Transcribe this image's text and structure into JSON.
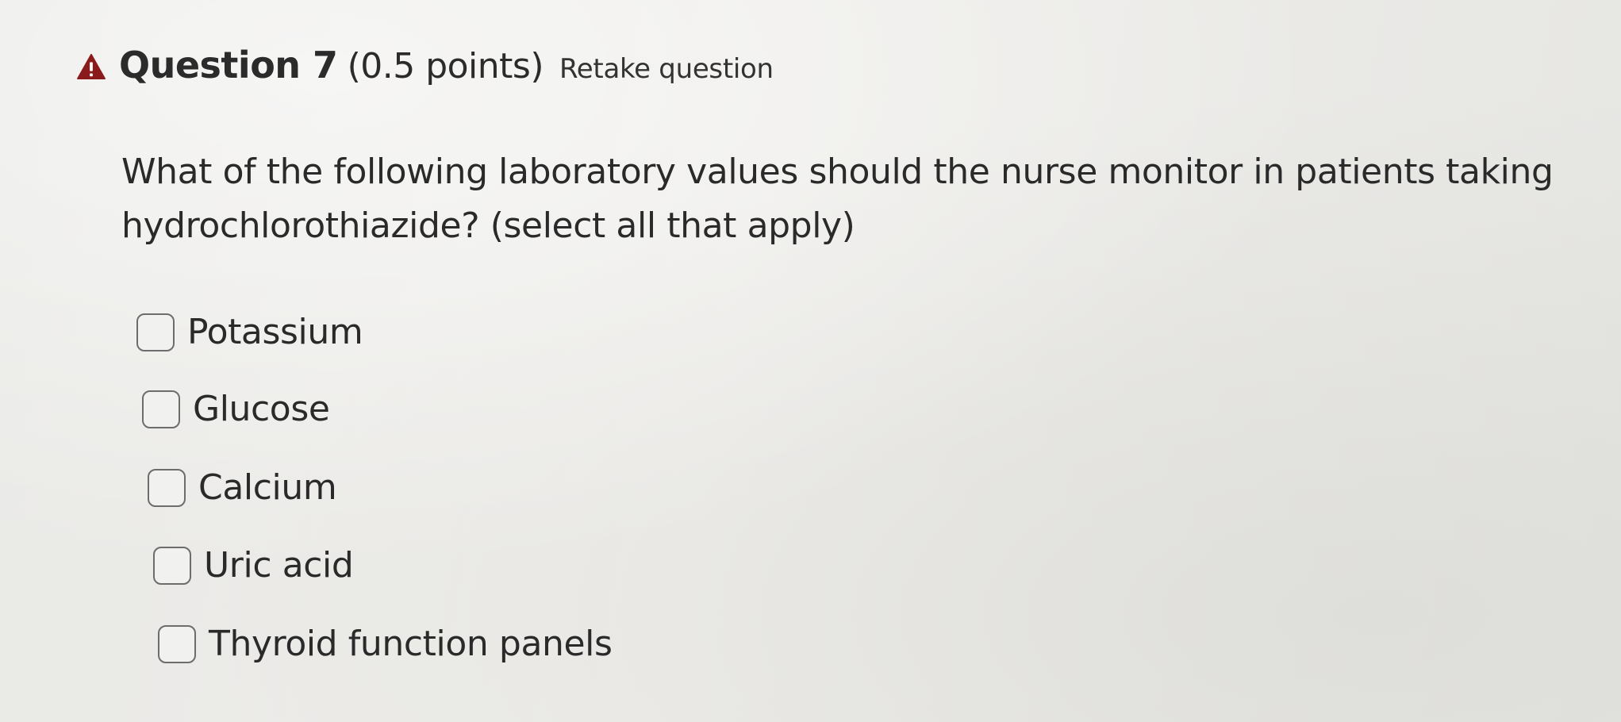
{
  "question": {
    "title": "Question 7",
    "points": "(0.5 points)",
    "retake_label": "Retake question",
    "text": "What of the following laboratory values should the nurse monitor in patients taking hydrochlorothiazide? (select all that apply)",
    "options": [
      {
        "label": "Potassium",
        "checked": false
      },
      {
        "label": "Glucose",
        "checked": false
      },
      {
        "label": "Calcium",
        "checked": false
      },
      {
        "label": "Uric acid",
        "checked": false
      },
      {
        "label": "Thyroid function panels",
        "checked": false
      }
    ]
  },
  "icons": {
    "warning": "warning-triangle-icon"
  },
  "colors": {
    "warning_icon": "#8b1a1a",
    "text": "#2a2a2a"
  }
}
